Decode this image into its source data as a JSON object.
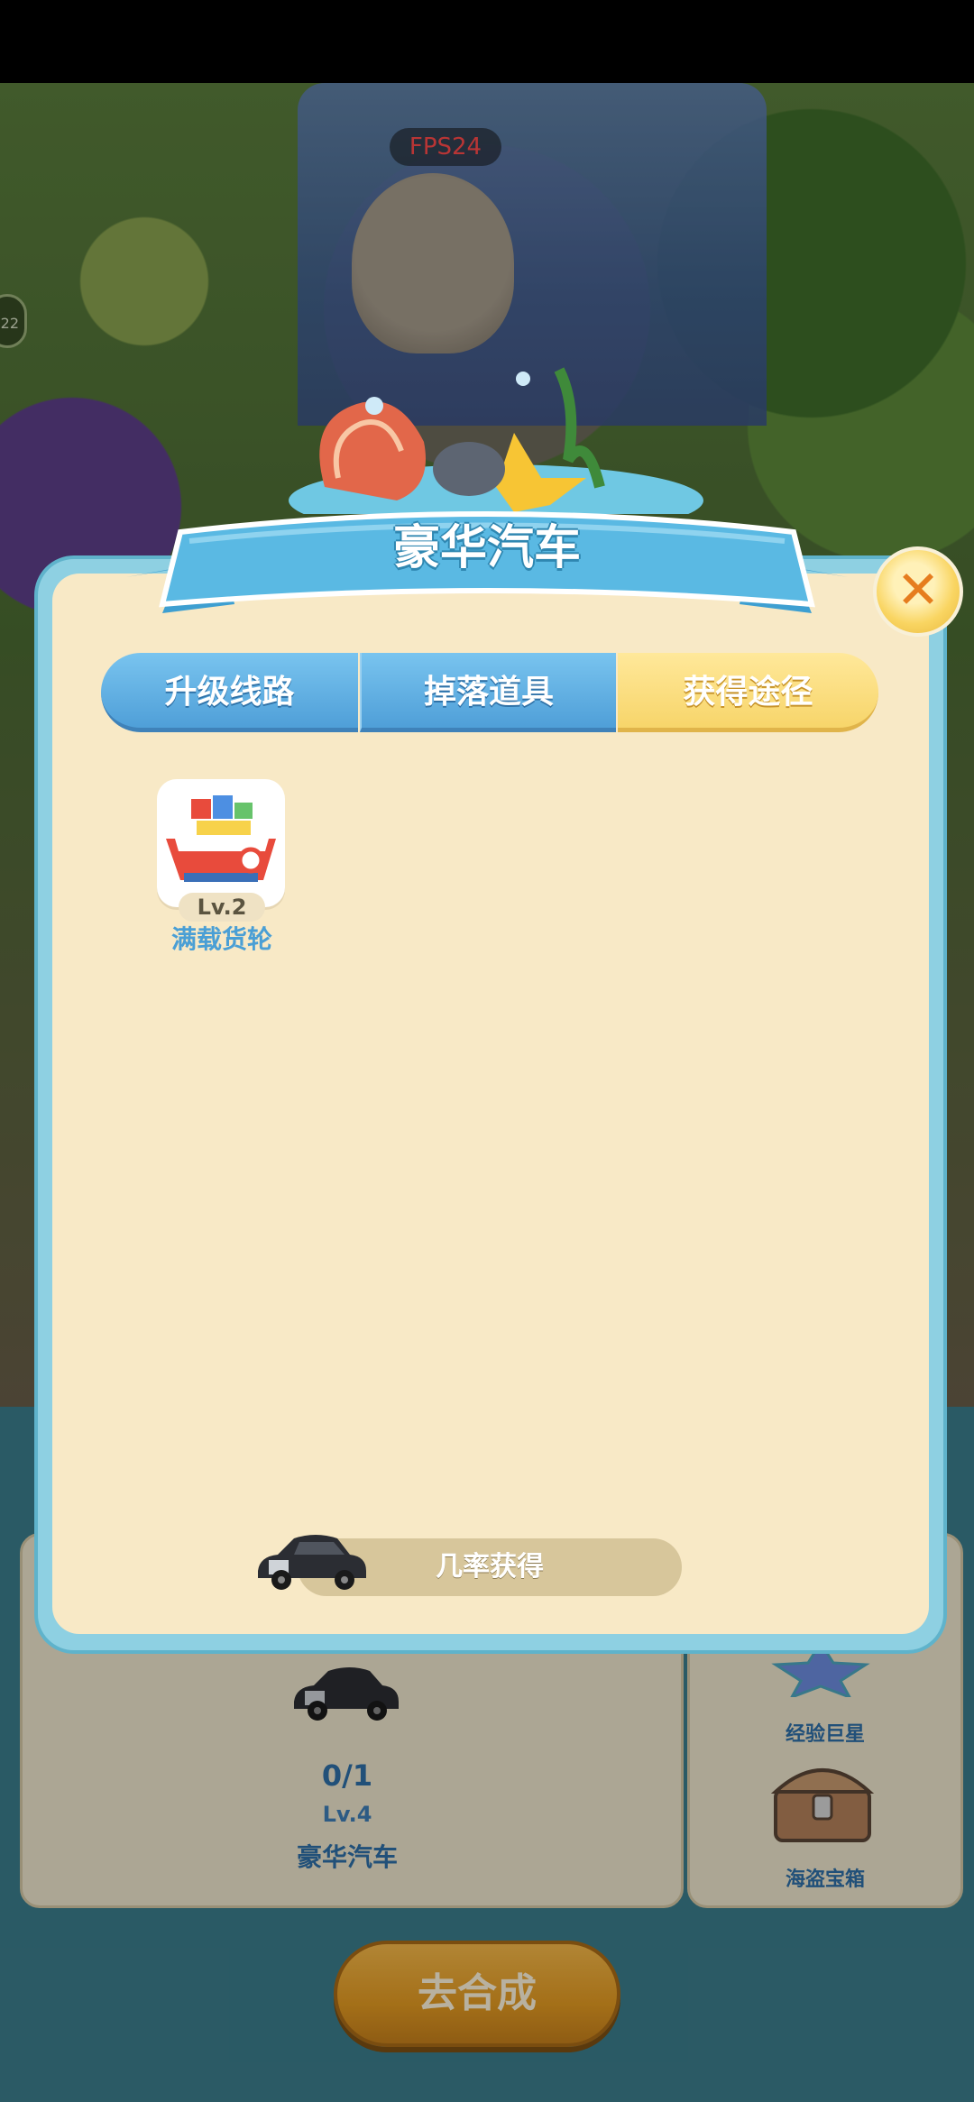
{
  "status_bar": {},
  "debug": {
    "fps": "FPS24"
  },
  "side_badge": {
    "value": "22"
  },
  "dialog": {
    "title": "豪华汽车",
    "close_icon": "close-x",
    "tabs": [
      {
        "label": "升级线路",
        "active": false
      },
      {
        "label": "掉落道具",
        "active": false
      },
      {
        "label": "获得途径",
        "active": true
      }
    ],
    "source_item": {
      "level": "Lv.2",
      "name": "满载货轮",
      "icon": "cargo-ship-icon"
    },
    "probability_label": "几率获得"
  },
  "bottom_panel": {
    "count": "0/1",
    "level": "Lv.4",
    "name": "豪华汽车",
    "right_items": [
      {
        "label": "经验巨星",
        "icon": "star-icon"
      },
      {
        "label": "海盗宝箱",
        "icon": "treasure-chest-icon"
      }
    ],
    "action_button": "去合成"
  },
  "colors": {
    "dialog_bg": "#f8e9c6",
    "dialog_border": "#8ed0e2",
    "tab_blue": "#4f9fd8",
    "tab_active": "#f7d56a",
    "title_ribbon": "#5ab9e3",
    "go_button": "#e49b22"
  }
}
